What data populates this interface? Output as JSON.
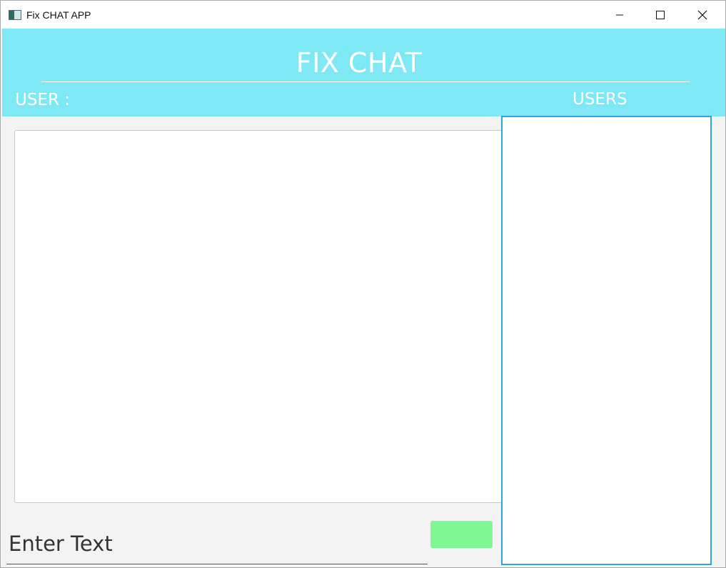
{
  "window": {
    "title": "Fix CHAT APP",
    "icon": "app-window-icon",
    "controls": [
      "minimize-icon",
      "maximize-icon",
      "close-icon"
    ]
  },
  "header": {
    "title": "FIX CHAT",
    "user_label": "USER :",
    "users_label": "USERS",
    "background_color": "#7ee8f5"
  },
  "chat": {
    "messages": []
  },
  "users": {
    "items": [],
    "border_color": "#2aa6dd"
  },
  "input": {
    "placeholder": "Enter Text",
    "value": ""
  },
  "send_button": {
    "label": "",
    "color": "#7ef794"
  }
}
